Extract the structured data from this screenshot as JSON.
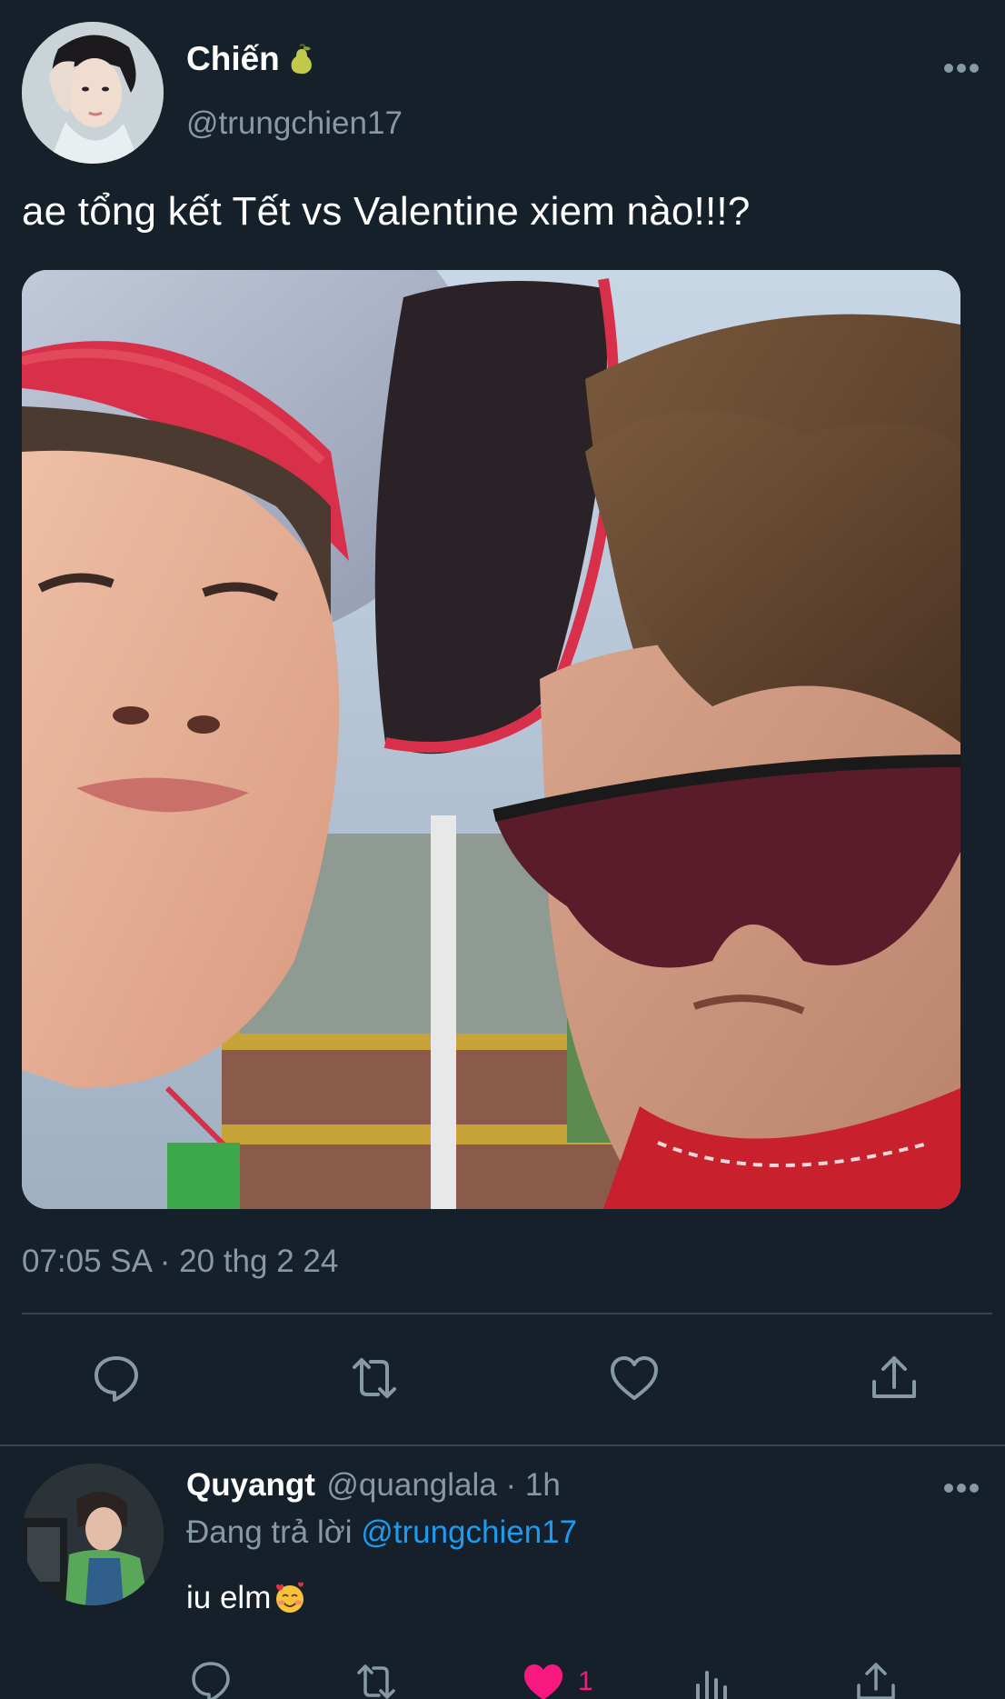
{
  "tweet": {
    "author": {
      "name": "Chiến",
      "badge_icon": "pear-icon",
      "handle": "@trungchien17"
    },
    "text": "ae tổng kết Tết vs Valentine xiem nào!!!?",
    "timestamp": "07:05 SA · 20 thg 2 24",
    "actions": [
      "reply-icon",
      "retweet-icon",
      "like-icon",
      "share-icon"
    ]
  },
  "reply": {
    "author": {
      "name": "Quyangt",
      "handle": "@quanglala",
      "time": " · 1h"
    },
    "replying_prefix": "Đang trả lời ",
    "replying_to": "@trungchien17",
    "text": "iu elm",
    "emoji": "smiling-face-with-hearts-icon",
    "like_count": "1",
    "actions": [
      "reply-icon",
      "retweet-icon",
      "like-icon-filled",
      "analytics-icon",
      "share-icon"
    ]
  },
  "colors": {
    "background": "#15202b",
    "secondary_text": "#8899a6",
    "link": "#1d9bf0",
    "like": "#f91880",
    "divider": "#38444d"
  }
}
